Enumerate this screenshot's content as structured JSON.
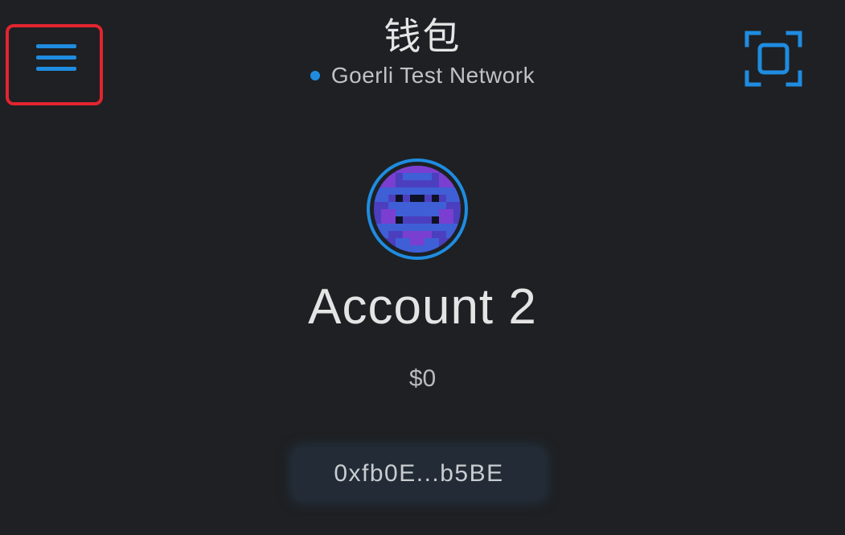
{
  "header": {
    "title": "钱包",
    "network": {
      "label": "Goerli Test Network",
      "dot_color": "#1f8ce0"
    },
    "menu_icon": "hamburger-menu-icon",
    "scan_icon": "qr-scan-icon"
  },
  "account": {
    "name": "Account 2",
    "balance": "$0",
    "address": "0xfb0E...b5BE",
    "avatar": "identicon"
  },
  "colors": {
    "accent": "#1f8ce0",
    "highlight_box": "#e3242f",
    "background": "#1e2023"
  }
}
